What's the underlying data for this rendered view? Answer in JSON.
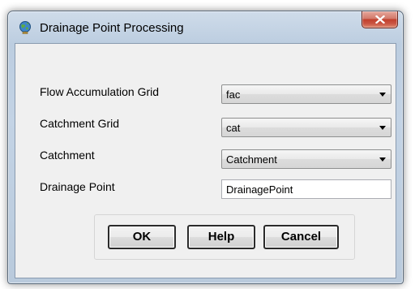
{
  "window": {
    "title": "Drainage Point Processing",
    "icon": "globe-icon",
    "close_icon": "close-icon"
  },
  "fields": [
    {
      "label": "Flow Accumulation Grid",
      "value": "fac",
      "type": "dropdown"
    },
    {
      "label": "Catchment Grid",
      "value": "cat",
      "type": "dropdown"
    },
    {
      "label": "Catchment",
      "value": "Catchment",
      "type": "dropdown"
    },
    {
      "label": "Drainage Point",
      "value": "DrainagePoint",
      "type": "text"
    }
  ],
  "buttons": {
    "ok": "OK",
    "help": "Help",
    "cancel": "Cancel"
  },
  "colors": {
    "close_button": "#c1402c",
    "client_background": "#f0f0f0",
    "frame": "#bccde0"
  }
}
